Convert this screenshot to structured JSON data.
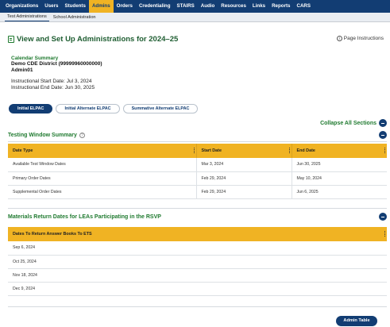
{
  "nav": {
    "items": [
      "Organizations",
      "Users",
      "Students",
      "Admins",
      "Orders",
      "Credentialing",
      "STAIRS",
      "Audio",
      "Resources",
      "Links",
      "Reports",
      "CARS"
    ],
    "active_index": 3
  },
  "subnav": {
    "items": [
      "Test Administrations",
      "School Administration"
    ],
    "active_index": 0
  },
  "page": {
    "title": "View and Set Up Administrations for 2024–25",
    "instructions_label": "Page Instructions"
  },
  "calendar": {
    "title": "Calendar Summary",
    "district": "Demo CDE District (99999960000000)",
    "admin": "Admin01",
    "start_line": "Instructional Start Date:  Jul 3, 2024",
    "end_line": "Instructional End Date:  Jun 30, 2025"
  },
  "tabs": [
    "Initial ELPAC",
    "Initial Alternate ELPAC",
    "Summative Alternate ELPAC"
  ],
  "active_tab_index": 0,
  "collapse_all_label": "Collapse All Sections",
  "testing_window": {
    "title": "Testing Window Summary",
    "columns": [
      "Date Type",
      "Start Date",
      "End Date"
    ],
    "rows": [
      [
        "Available Test Window Dates",
        "Mar 3, 2024",
        "Jun 30, 2025"
      ],
      [
        "Primary Order Dates",
        "Feb 29, 2024",
        "May 10, 2024"
      ],
      [
        "Supplemental Order Dates",
        "Feb 29, 2024",
        "Jun 6, 2025"
      ]
    ]
  },
  "materials_return": {
    "title": "Materials Return Dates for LEAs Participating in the RSVP",
    "column": "Dates To Return Answer Books To ETS",
    "rows": [
      "Sep 6, 2024",
      "Oct 25, 2024",
      "Nov 18, 2024",
      "Dec 9, 2024"
    ]
  },
  "admin_table_label": "Admin Table",
  "colors": {
    "nav_bg": "#123d73",
    "accent_gold": "#f0b323",
    "green_heading": "#1f7a2f"
  },
  "icons": [
    "table-icon",
    "info-icon",
    "help-icon",
    "minus-circle-icon"
  ]
}
